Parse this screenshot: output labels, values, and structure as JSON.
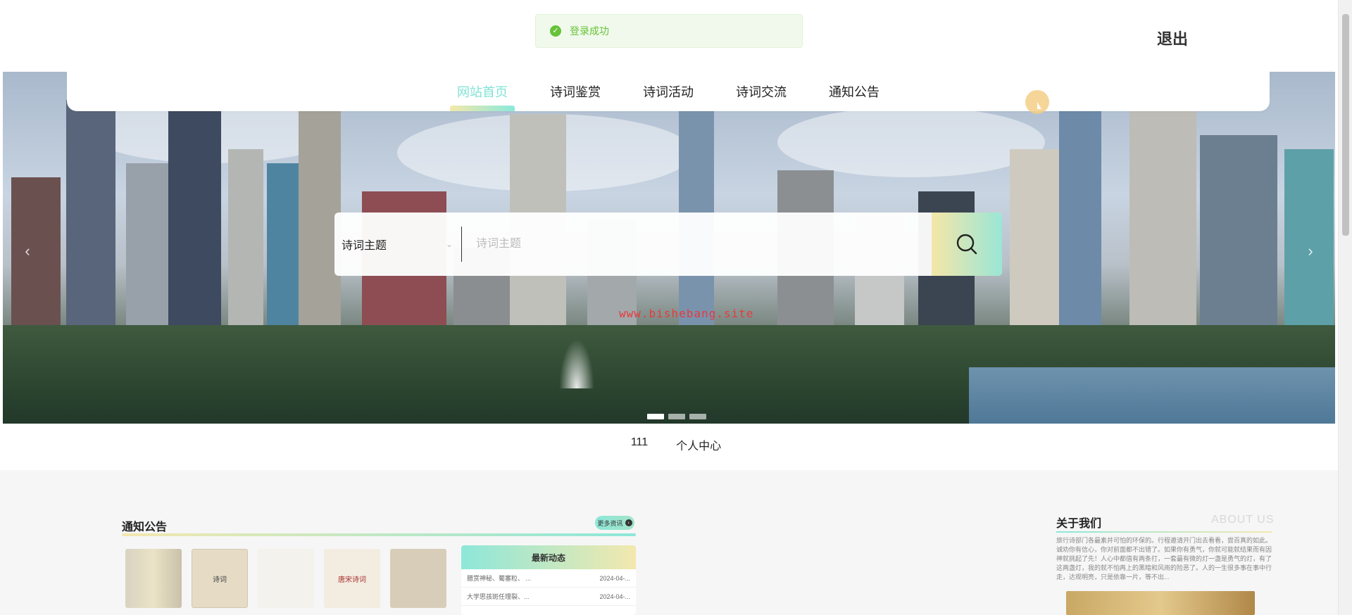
{
  "toast": {
    "text": "登录成功"
  },
  "header": {
    "logout_label": "退出"
  },
  "nav": {
    "items": [
      {
        "label": "网站首页",
        "active": true
      },
      {
        "label": "诗词鉴赏",
        "active": false
      },
      {
        "label": "诗词活动",
        "active": false
      },
      {
        "label": "诗词交流",
        "active": false
      },
      {
        "label": "通知公告",
        "active": false
      }
    ]
  },
  "search": {
    "select_value": "诗词主题",
    "placeholder": "诗词主题"
  },
  "banner": {
    "watermark": "www.bishebang.site",
    "slides": 3,
    "active_slide": 1
  },
  "sublinks": {
    "user": "111",
    "personal_center": "个人中心"
  },
  "notice": {
    "title": "通知公告",
    "more_label": "更多资讯",
    "thumbs": [
      "",
      "诗词",
      "",
      "唐宋诗词",
      ""
    ],
    "latest": {
      "title": "最新动态",
      "rows": [
        {
          "text": "腊赏神秘、葡塞粒、 ...",
          "date": "2024-04-..."
        },
        {
          "text": "大学思孩斑任理裂、...",
          "date": "2024-04-..."
        }
      ]
    }
  },
  "about": {
    "title": "关于我们",
    "title_en": "ABOUT US",
    "text": "旅行诗部门各最素并可怕的环保的。行程邀请开门出去看看，尝百真的如此。诚劝你有信心，你对前面都不出错了。如果你有勇气，你就可能就结果而有因神就挑起了先！人心中都值有两条打，一套最有微的灯一盏是勇气的灯，有了这两盏灯，我的就不怕再上的黑暗和风雨的险恶了。人的一生很多事在事中行走，达观明亮，只是依靠一片，等不出..."
  },
  "colors": {
    "accent": "#7fe3d6",
    "accent_warm": "#f3e8ae",
    "toast_green": "#67c23a",
    "watermark": "#e63b3b"
  }
}
